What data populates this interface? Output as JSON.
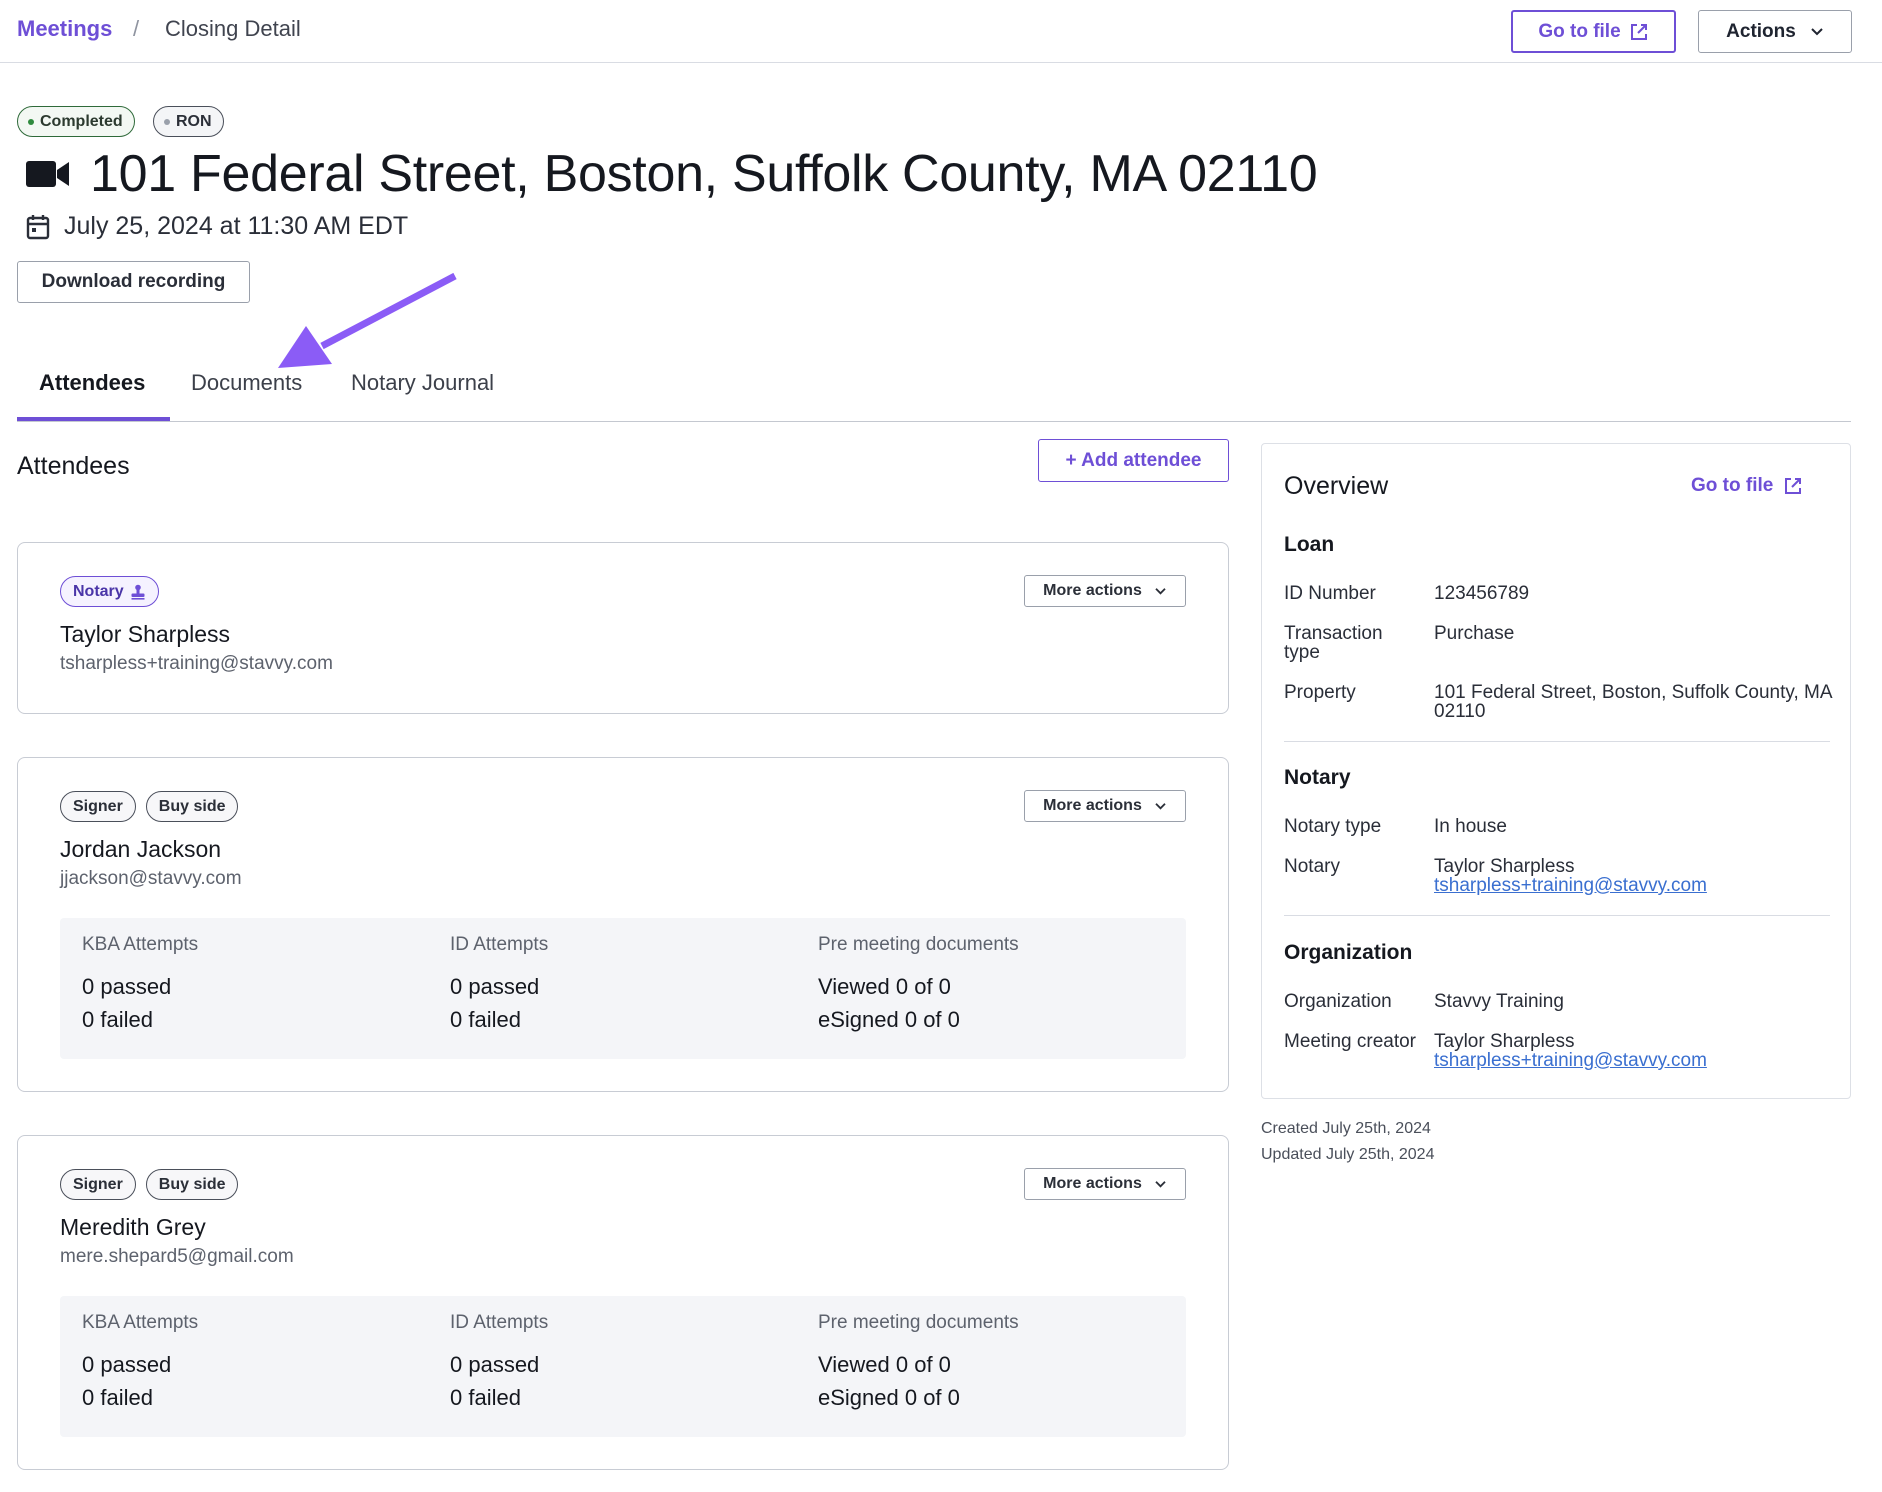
{
  "breadcrumb": {
    "parent": "Meetings",
    "separator": "/",
    "current": "Closing Detail"
  },
  "header_actions": {
    "goto_file_label": "Go to file",
    "actions_label": "Actions"
  },
  "status": {
    "completed_label": "Completed",
    "type_label": "RON"
  },
  "meeting": {
    "title": "101 Federal Street, Boston, Suffolk County, MA 02110",
    "datetime": "July 25, 2024 at 11:30 AM EDT",
    "download_label": "Download recording"
  },
  "tabs": [
    {
      "label": "Attendees",
      "active": true
    },
    {
      "label": "Documents",
      "active": false
    },
    {
      "label": "Notary Journal",
      "active": false
    }
  ],
  "attendees_section": {
    "title": "Attendees",
    "add_label": "+ Add attendee"
  },
  "attendees": [
    {
      "tags": [
        "Notary"
      ],
      "more_actions": "More actions",
      "name": "Taylor Sharpless",
      "email": "tsharpless+training@stavvy.com"
    },
    {
      "tags": [
        "Signer",
        "Buy side"
      ],
      "more_actions": "More actions",
      "name": "Jordan Jackson",
      "email": "jjackson@stavvy.com",
      "stats": {
        "kba_label": "KBA Attempts",
        "kba_passed": "0 passed",
        "kba_failed": "0 failed",
        "id_label": "ID Attempts",
        "id_passed": "0 passed",
        "id_failed": "0 failed",
        "docs_label": "Pre meeting documents",
        "docs_viewed": "Viewed 0 of 0",
        "docs_esigned": "eSigned 0 of 0"
      }
    },
    {
      "tags": [
        "Signer",
        "Buy side"
      ],
      "more_actions": "More actions",
      "name": "Meredith Grey",
      "email": "mere.shepard5@gmail.com",
      "stats": {
        "kba_label": "KBA Attempts",
        "kba_passed": "0 passed",
        "kba_failed": "0 failed",
        "id_label": "ID Attempts",
        "id_passed": "0 passed",
        "id_failed": "0 failed",
        "docs_label": "Pre meeting documents",
        "docs_viewed": "Viewed 0 of 0",
        "docs_esigned": "eSigned 0 of 0"
      }
    }
  ],
  "overview": {
    "title": "Overview",
    "goto_file_label": "Go to file",
    "loan": {
      "heading": "Loan",
      "id_key": "ID Number",
      "id_val": "123456789",
      "transaction_key": "Transaction type",
      "transaction_val": "Purchase",
      "property_key": "Property",
      "property_val": "101 Federal Street, Boston, Suffolk County, MA 02110"
    },
    "notary": {
      "heading": "Notary",
      "type_key": "Notary type",
      "type_val": "In house",
      "notary_key": "Notary",
      "notary_name": "Taylor Sharpless",
      "notary_email": "tsharpless+training@stavvy.com"
    },
    "organization": {
      "heading": "Organization",
      "org_key": "Organization",
      "org_val": "Stavvy Training",
      "creator_key": "Meeting creator",
      "creator_name": "Taylor Sharpless",
      "creator_email": "tsharpless+training@stavvy.com"
    }
  },
  "meta": {
    "created": "Created July 25th, 2024",
    "updated": "Updated July 25th, 2024"
  },
  "colors": {
    "accent": "#6e4fd6",
    "completed_dot": "#2f8a3e",
    "link": "#3a6fd0",
    "annotation_arrow": "#8b5cf6"
  },
  "icons": {
    "external_link": "external-link-icon",
    "chevron": "chevron-down-icon",
    "video": "video-camera-icon",
    "calendar": "calendar-icon",
    "notary_stamp": "stamp-icon"
  }
}
